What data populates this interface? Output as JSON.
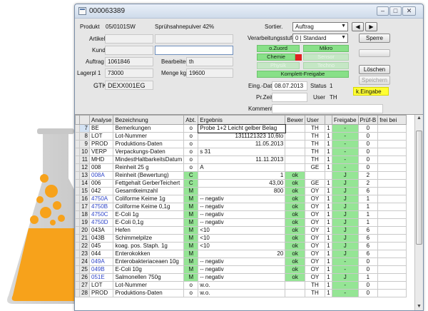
{
  "window": {
    "title": "000063389"
  },
  "form": {
    "produkt_label": "Produkt",
    "produkt_code": "05/0101SW",
    "produkt_name": "Sprühsahnepulver 42%",
    "artikel_label": "Artikel",
    "artikel_value": "",
    "kunde_label": "Kunde",
    "kunde_value": "",
    "auftrag_label": "Auftrag",
    "auftrag_value": "1061846",
    "lagerpl_label": "Lagerpl 1",
    "lagerpl_value": "73000",
    "gtk_label": "GTK",
    "gtk_value": "DEXX001EG",
    "bearbeiter_label": "Bearbeiter",
    "bearbeiter_value": "th",
    "menge_label": "Menge kg",
    "menge_value": "19600",
    "sortier_label": "Sortier.",
    "sortier_value": "Auftrag",
    "verarbeitungsstufe_label": "Verarbeitungsstufe",
    "verarbeitungsstufe_value": "0 | Standard",
    "eing_dat_label": "Eing.-Dat.",
    "eing_dat_value": "08.07.2013",
    "status_label": "Status",
    "status_value": "1",
    "pr_zeit_label": "Pr.Zeit",
    "pr_zeit_value": "",
    "user_label": "User",
    "user_value": "TH",
    "komment_label": "Komment.",
    "komment_value": ""
  },
  "flags": {
    "o_zuord": "o.Zuord",
    "mikro": "Mikro",
    "chemie": "Chemie",
    "sensor": "Sensor",
    "physik": "Physik",
    "techno": "Techno",
    "komplett_freigabe": "Komplett-Freigabe"
  },
  "buttons": {
    "prev": "◀",
    "next": "▶",
    "sperre": "Sperre",
    "loeschen": "Löschen",
    "speichern": "Speichern",
    "k_eingabe": "k.Eingabe"
  },
  "table": {
    "headers": [
      "",
      "Analyse",
      "Bezeichnung",
      "Abt.",
      "Ergebnis",
      "Bewer",
      "User",
      "",
      "Freigabe",
      "Prüf-B",
      "frei bei"
    ],
    "rows": [
      {
        "n": "7",
        "code": "BE",
        "desc": "Bemerkungen",
        "abt": "o",
        "result": "Probe 1+2 Leicht gelber Belag",
        "bew": "",
        "user": "TH",
        "c": "1",
        "frei": "-",
        "prf": "0"
      },
      {
        "n": "8",
        "code": "LOT",
        "desc": "Lot-Nummer",
        "abt": "o",
        "result": "1311121323  10,6to",
        "bew": "",
        "user": "TH",
        "c": "1",
        "frei": "-",
        "prf": "0"
      },
      {
        "n": "9",
        "code": "PROD",
        "desc": "Produktions-Daten",
        "abt": "o",
        "result": "11.05.2013",
        "bew": "",
        "user": "TH",
        "c": "1",
        "frei": "-",
        "prf": "0"
      },
      {
        "n": "10",
        "code": "VERP",
        "desc": "Verpackungs-Daten",
        "abt": "o",
        "result": "s 31",
        "bew": "",
        "user": "TH",
        "c": "1",
        "frei": "-",
        "prf": "0"
      },
      {
        "n": "11",
        "code": "MHD",
        "desc": "MindestHaltbarkeitsDatum",
        "abt": "o",
        "result": "11.11.2013",
        "bew": "",
        "user": "TH",
        "c": "1",
        "frei": "-",
        "prf": "0"
      },
      {
        "n": "12",
        "code": "008",
        "desc": "Reinheit 25 g",
        "abt": "o",
        "result": "A",
        "bew": "",
        "user": "GE",
        "c": "1",
        "frei": "-",
        "prf": "0"
      },
      {
        "n": "13",
        "code": "008A",
        "desc": "Reinheit (Bewertung)",
        "abt": "C",
        "result": "1",
        "bew": "ok",
        "user": "",
        "c": "",
        "frei": "J",
        "prf": "2"
      },
      {
        "n": "14",
        "code": "006",
        "desc": "Fettgehalt GerberTeichert",
        "abt": "C",
        "result": "43,00",
        "bew": "ok",
        "user": "GE",
        "c": "1",
        "frei": "J",
        "prf": "2"
      },
      {
        "n": "15",
        "code": "042",
        "desc": "Gesamtkeimzahl",
        "abt": "M",
        "result": "800",
        "bew": "ok",
        "user": "OY",
        "c": "1",
        "frei": "J",
        "prf": "6"
      },
      {
        "n": "16",
        "code": "4750A",
        "desc": "Coliforme Keime 1g",
        "abt": "M",
        "result": "-- negativ",
        "bew": "ok",
        "user": "OY",
        "c": "1",
        "frei": "J",
        "prf": "1"
      },
      {
        "n": "17",
        "code": "4750B",
        "desc": "Coliforme Keime 0,1g",
        "abt": "M",
        "result": "-- negativ",
        "bew": "ok",
        "user": "OY",
        "c": "1",
        "frei": "J",
        "prf": "1"
      },
      {
        "n": "18",
        "code": "4750C",
        "desc": "E-Coli 1g",
        "abt": "M",
        "result": "-- negativ",
        "bew": "ok",
        "user": "OY",
        "c": "1",
        "frei": "J",
        "prf": "1"
      },
      {
        "n": "19",
        "code": "4750D",
        "desc": "E-Coli 0,1g",
        "abt": "M",
        "result": "-- negativ",
        "bew": "ok",
        "user": "OY",
        "c": "1",
        "frei": "J",
        "prf": "1"
      },
      {
        "n": "20",
        "code": "043A",
        "desc": "Hefen",
        "abt": "M",
        "result": "<10",
        "bew": "ok",
        "user": "OY",
        "c": "1",
        "frei": "J",
        "prf": "6"
      },
      {
        "n": "21",
        "code": "043B",
        "desc": "Schimmelpilze",
        "abt": "M",
        "result": "<10",
        "bew": "ok",
        "user": "OY",
        "c": "1",
        "frei": "J",
        "prf": "6"
      },
      {
        "n": "22",
        "code": "045",
        "desc": "koag. pos. Staph. 1g",
        "abt": "M",
        "result": "<10",
        "bew": "ok",
        "user": "OY",
        "c": "1",
        "frei": "J",
        "prf": "6"
      },
      {
        "n": "23",
        "code": "044",
        "desc": "Enterokokken",
        "abt": "M",
        "result": "20",
        "bew": "ok",
        "user": "OY",
        "c": "1",
        "frei": "J",
        "prf": "6"
      },
      {
        "n": "24",
        "code": "049A",
        "desc": "Enterobakteriaceaen 10g",
        "abt": "M",
        "result": "-- negativ",
        "bew": "ok",
        "user": "OY",
        "c": "1",
        "frei": "-",
        "prf": "0"
      },
      {
        "n": "25",
        "code": "049B",
        "desc": "E-Coli 10g",
        "abt": "M",
        "result": "-- negativ",
        "bew": "ok",
        "user": "OY",
        "c": "1",
        "frei": "-",
        "prf": "0"
      },
      {
        "n": "26",
        "code": "051E",
        "desc": "Salmonellen 750g",
        "abt": "M",
        "result": "-- negativ",
        "bew": "ok",
        "user": "OY",
        "c": "1",
        "frei": "J",
        "prf": "1"
      },
      {
        "n": "27",
        "code": "LOT",
        "desc": "Lot-Nummer",
        "abt": "o",
        "result": "w.o.",
        "bew": "",
        "user": "TH",
        "c": "1",
        "frei": "-",
        "prf": "0"
      },
      {
        "n": "28",
        "code": "PROD",
        "desc": "Produktions-Daten",
        "abt": "o",
        "result": "w.o.",
        "bew": "",
        "user": "TH",
        "c": "1",
        "frei": "-",
        "prf": "0"
      }
    ]
  },
  "colors": {
    "accent_green": "#95e595",
    "flag_red": "#e02020",
    "highlight_yellow": "#ffff33",
    "flask_orange": "#f7a21b"
  }
}
